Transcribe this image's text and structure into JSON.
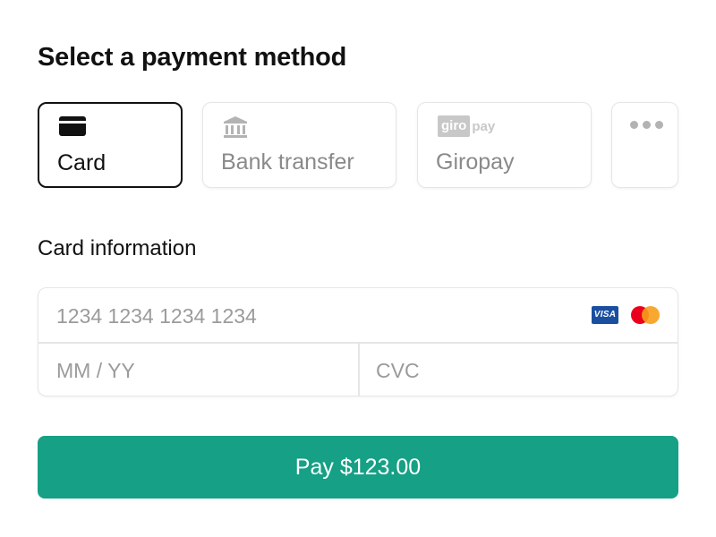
{
  "page": {
    "title": "Select a payment method"
  },
  "methods": [
    {
      "label": "Card",
      "icon": "credit-card-icon",
      "selected": true
    },
    {
      "label": "Bank transfer",
      "icon": "bank-icon",
      "selected": false
    },
    {
      "label": "Giropay",
      "icon": "giropay-logo",
      "logo_text_box": "giro",
      "logo_text": "pay",
      "selected": false
    },
    {
      "label": "",
      "icon": "more-options-icon",
      "selected": false
    }
  ],
  "card_info": {
    "label": "Card information",
    "number_placeholder": "1234 1234 1234 1234",
    "expiry_placeholder": "MM / YY",
    "cvc_placeholder": "CVC",
    "brands": [
      {
        "name": "visa-logo",
        "text": "VISA",
        "color": "#1a4fa0"
      },
      {
        "name": "mastercard-logo",
        "colors": [
          "#eb001b",
          "#f79e1b"
        ]
      }
    ]
  },
  "pay_button": {
    "label": "Pay $123.00",
    "color": "#16a085"
  }
}
